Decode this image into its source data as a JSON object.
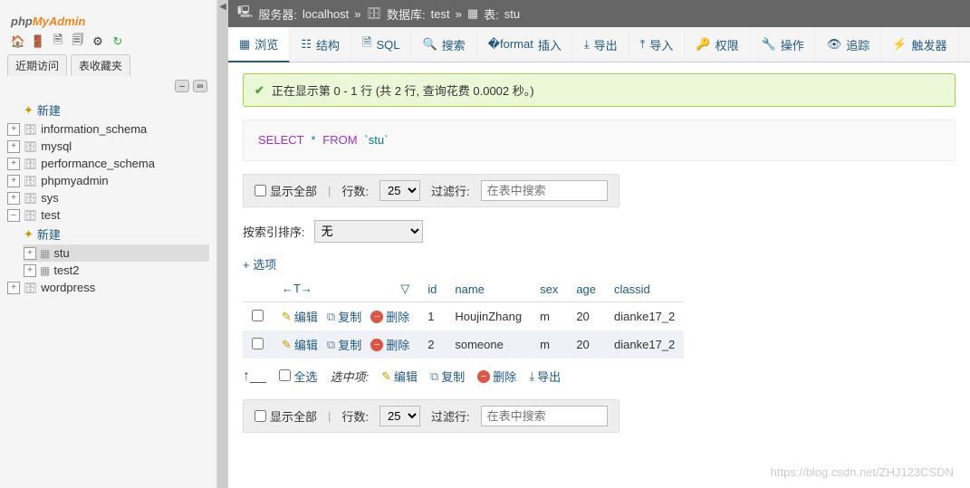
{
  "sidebar": {
    "tabs": {
      "recent": "近期访问",
      "favorites": "表收藏夹"
    },
    "new_label": "新建",
    "databases": [
      "information_schema",
      "mysql",
      "performance_schema",
      "phpmyadmin",
      "sys",
      "test",
      "wordpress"
    ],
    "test_children": {
      "new": "新建",
      "tables": [
        "stu",
        "test2"
      ]
    }
  },
  "breadcrumb": {
    "server_lbl": "服务器:",
    "server": "localhost",
    "db_lbl": "数据库:",
    "db": "test",
    "tbl_lbl": "表:",
    "tbl": "stu",
    "sep": "»"
  },
  "tabs": {
    "browse": "浏览",
    "structure": "结构",
    "sql": "SQL",
    "search": "搜索",
    "insert": "插入",
    "export": "导出",
    "import": "导入",
    "privileges": "权限",
    "operations": "操作",
    "tracking": "追踪",
    "triggers": "触发器"
  },
  "success": "正在显示第 0 - 1 行 (共 2 行, 查询花费 0.0002 秒。)",
  "sql": {
    "select": "SELECT",
    "star": "*",
    "from": "FROM",
    "table": "`stu`"
  },
  "controls": {
    "show_all": "显示全部",
    "rows_lbl": "行数:",
    "rows_val": "25",
    "filter_lbl": "过滤行:",
    "filter_placeholder": "在表中搜索"
  },
  "sort": {
    "label": "按索引排序:",
    "value": "无"
  },
  "options": "+ 选项",
  "columns": [
    "id",
    "name",
    "sex",
    "age",
    "classid"
  ],
  "row_actions": {
    "edit": "编辑",
    "copy": "复制",
    "delete": "删除"
  },
  "rows": [
    {
      "id": "1",
      "name": "HoujinZhang",
      "sex": "m",
      "age": "20",
      "classid": "dianke17_2"
    },
    {
      "id": "2",
      "name": "someone",
      "sex": "m",
      "age": "20",
      "classid": "dianke17_2"
    }
  ],
  "bulk": {
    "select_all": "全选",
    "with_selected": "选中项:",
    "edit": "编辑",
    "copy": "复制",
    "delete": "删除",
    "export": "导出"
  },
  "watermark": "https://blog.csdn.net/ZHJ123CSDN"
}
